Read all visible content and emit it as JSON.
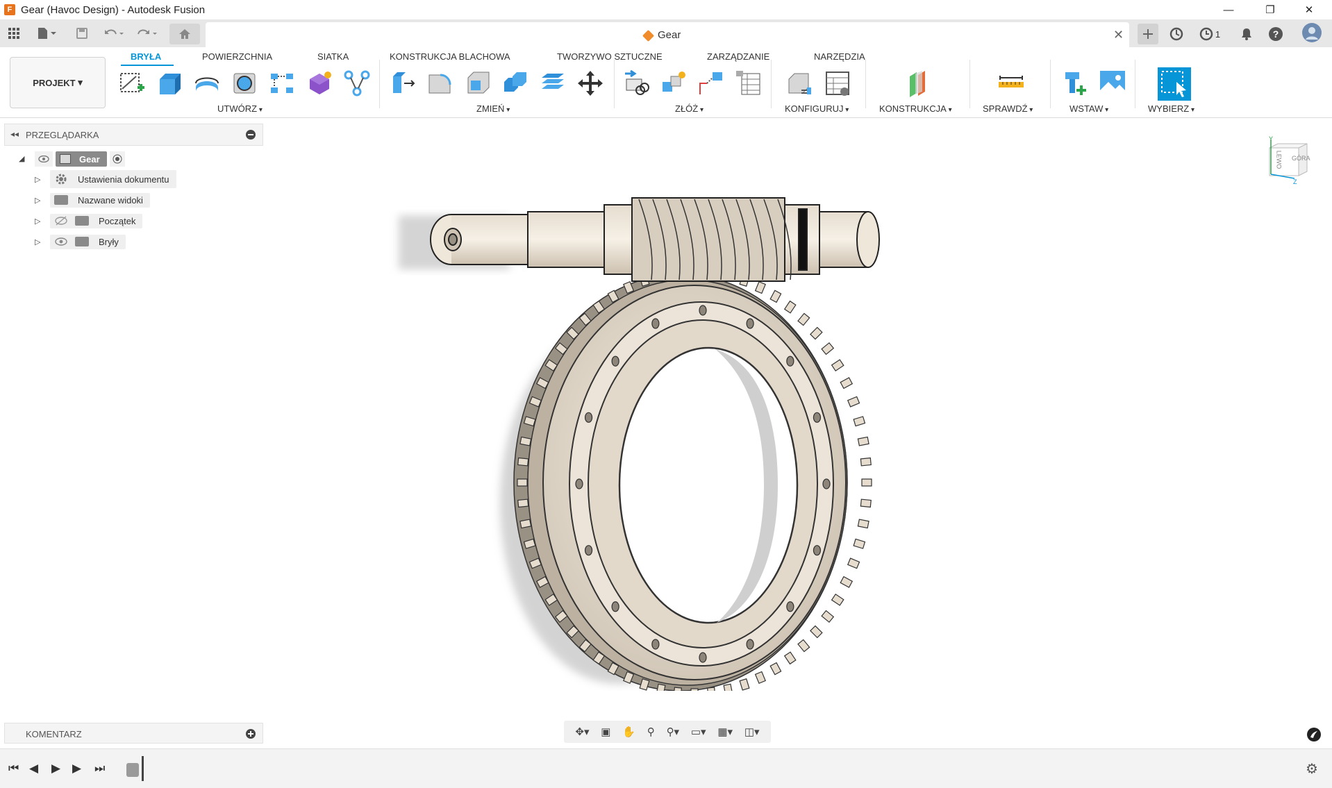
{
  "window": {
    "title": "Gear (Havoc Design) - Autodesk Fusion",
    "logo_letter": "F",
    "minimize": "—",
    "restore": "❐",
    "close": "✕"
  },
  "tabs": {
    "document_tab": "Gear",
    "notification_count": "1"
  },
  "toolbar": {
    "project_button": "PROJEKT",
    "workspace_tabs": [
      "BRYŁA",
      "POWIERZCHNIA",
      "SIATKA",
      "KONSTRUKCJA BLACHOWA",
      "TWORZYWO SZTUCZNE",
      "ZARZĄDZANIE",
      "NARZĘDZIA"
    ],
    "active_tab": "BRYŁA",
    "groups": [
      "UTWÓRZ",
      "ZMIEŃ",
      "ZŁÓŻ",
      "KONFIGURUJ",
      "KONSTRUKCJA",
      "SPRAWDŹ",
      "WSTAW",
      "WYBIERZ"
    ],
    "accent_color": "#0696d7"
  },
  "browser": {
    "title": "PRZEGLĄDARKA",
    "root": "Gear",
    "items": [
      "Ustawienia dokumentu",
      "Nazwane widoki",
      "Początek",
      "Bryły"
    ]
  },
  "comments": {
    "title": "KOMENTARZ"
  },
  "viewcube": {
    "left": "LEWO",
    "top": "GÓRA",
    "axis_y": "Y",
    "axis_z": "Z"
  }
}
